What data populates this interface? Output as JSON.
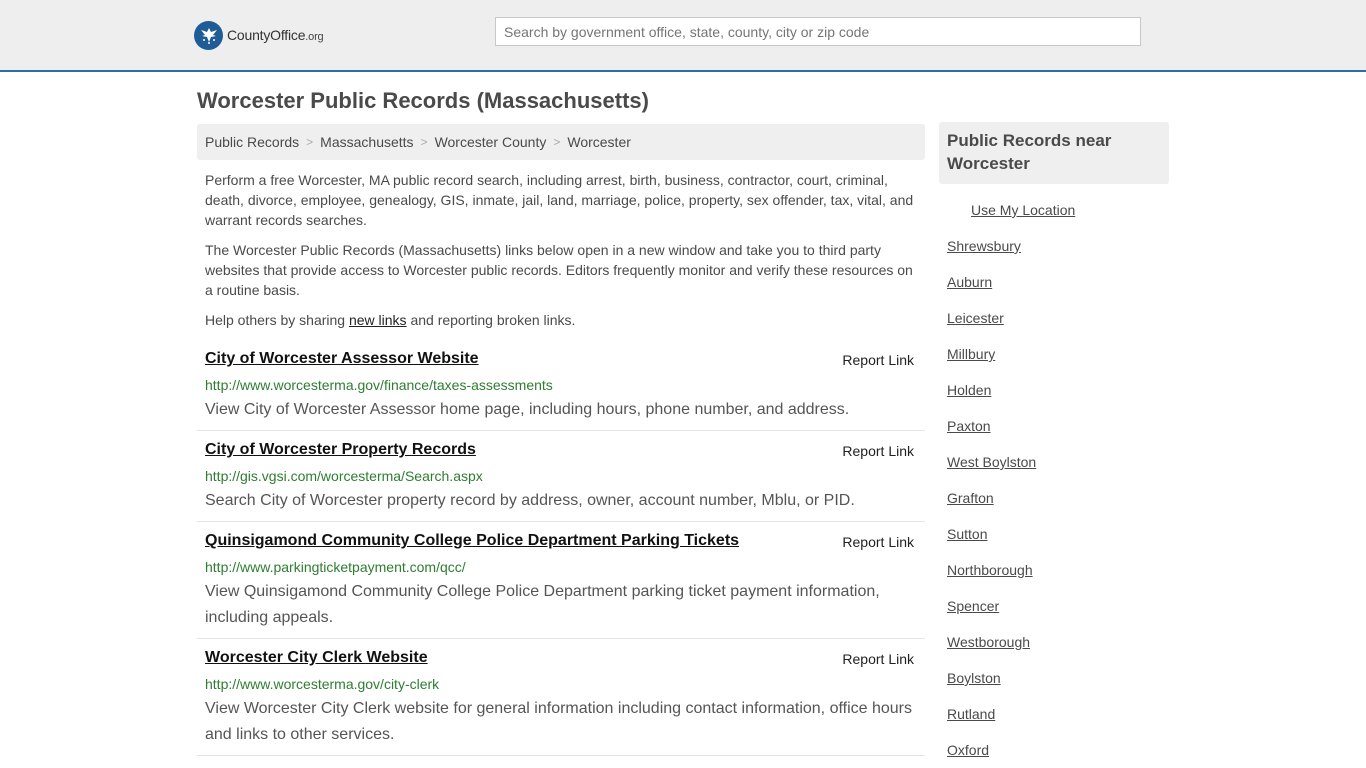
{
  "header": {
    "logo_name": "County",
    "logo_name_bold": "Office",
    "logo_tld": ".org",
    "search_placeholder": "Search by government office, state, county, city or zip code"
  },
  "page_title": "Worcester Public Records (Massachusetts)",
  "breadcrumb": [
    "Public Records",
    "Massachusetts",
    "Worcester County",
    "Worcester"
  ],
  "intro": {
    "p1": "Perform a free Worcester, MA public record search, including arrest, birth, business, contractor, court, criminal, death, divorce, employee, genealogy, GIS, inmate, jail, land, marriage, police, property, sex offender, tax, vital, and warrant records searches.",
    "p2": "The Worcester Public Records (Massachusetts) links below open in a new window and take you to third party websites that provide access to Worcester public records. Editors frequently monitor and verify these resources on a routine basis.",
    "p3_before": "Help others by sharing ",
    "p3_link": "new links",
    "p3_after": " and reporting broken links."
  },
  "report_label": "Report Link",
  "records": [
    {
      "title": "City of Worcester Assessor Website",
      "url": "http://www.worcesterma.gov/finance/taxes-assessments",
      "desc": "View City of Worcester Assessor home page, including hours, phone number, and address."
    },
    {
      "title": "City of Worcester Property Records",
      "url": "http://gis.vgsi.com/worcesterma/Search.aspx",
      "desc": "Search City of Worcester property record by address, owner, account number, Mblu, or PID."
    },
    {
      "title": "Quinsigamond Community College Police Department Parking Tickets",
      "url": "http://www.parkingticketpayment.com/qcc/",
      "desc": "View Quinsigamond Community College Police Department parking ticket payment information, including appeals."
    },
    {
      "title": "Worcester City Clerk Website",
      "url": "http://www.worcesterma.gov/city-clerk",
      "desc": "View Worcester City Clerk website for general information including contact information, office hours and links to other services."
    }
  ],
  "sidebar": {
    "heading": "Public Records near Worcester",
    "use_location": "Use My Location",
    "places": [
      "Shrewsbury",
      "Auburn",
      "Leicester",
      "Millbury",
      "Holden",
      "Paxton",
      "West Boylston",
      "Grafton",
      "Sutton",
      "Northborough",
      "Spencer",
      "Westborough",
      "Boylston",
      "Rutland",
      "Oxford"
    ]
  }
}
